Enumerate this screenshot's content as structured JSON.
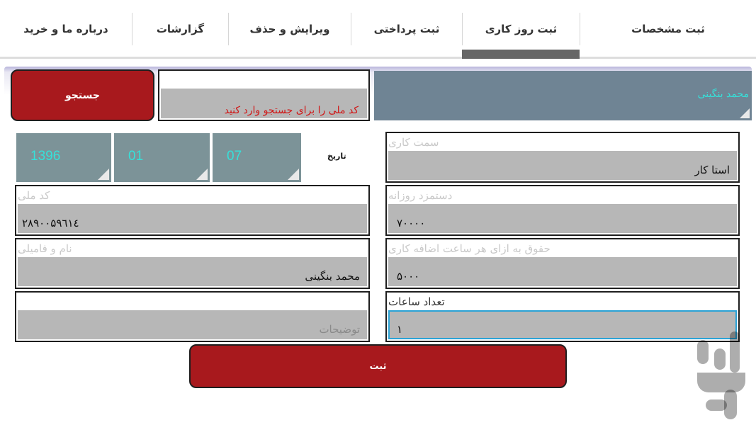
{
  "tabs": [
    {
      "label": "ثبت مشخصات"
    },
    {
      "label": "ثبت روز کاری",
      "selected": true
    },
    {
      "label": "ثبت پرداختی"
    },
    {
      "label": "ویرایش و حذف"
    },
    {
      "label": "گزارشات"
    },
    {
      "label": "درباره ما و خرید"
    }
  ],
  "search": {
    "button_label": "جستجو",
    "placeholder": "کد ملی را برای جستجو وارد کنید"
  },
  "user": {
    "name": "محمد  بنگینی"
  },
  "date": {
    "label": "تاریخ",
    "year": "1396",
    "month": "01",
    "day": "07"
  },
  "form": {
    "job_title": {
      "label": "سمت کاری",
      "value": "استا کار"
    },
    "daily_wage": {
      "label": "دستمزد روزانه",
      "value": "۷۰۰۰۰"
    },
    "overtime_pay": {
      "label": "حقوق به ازای هر ساعت اضافه کاری",
      "value": "۵۰۰۰"
    },
    "hours": {
      "label": "تعداد ساعات",
      "value": "۱"
    },
    "national_id": {
      "label": "کد ملی",
      "value": "۲۸۹۰۰۵۹٦۱٤"
    },
    "full_name": {
      "label": "نام و فامیلی",
      "value": "محمد  بنگینی"
    },
    "notes": {
      "placeholder": "توضیحات"
    }
  },
  "submit_label": "ثبت",
  "colors": {
    "accent_red": "#a8191d",
    "cyan_text": "#36e0d9",
    "panel_slate": "#6f8494",
    "spinner_gray": "#7c9398",
    "field_fill": "#b7b7b7"
  }
}
